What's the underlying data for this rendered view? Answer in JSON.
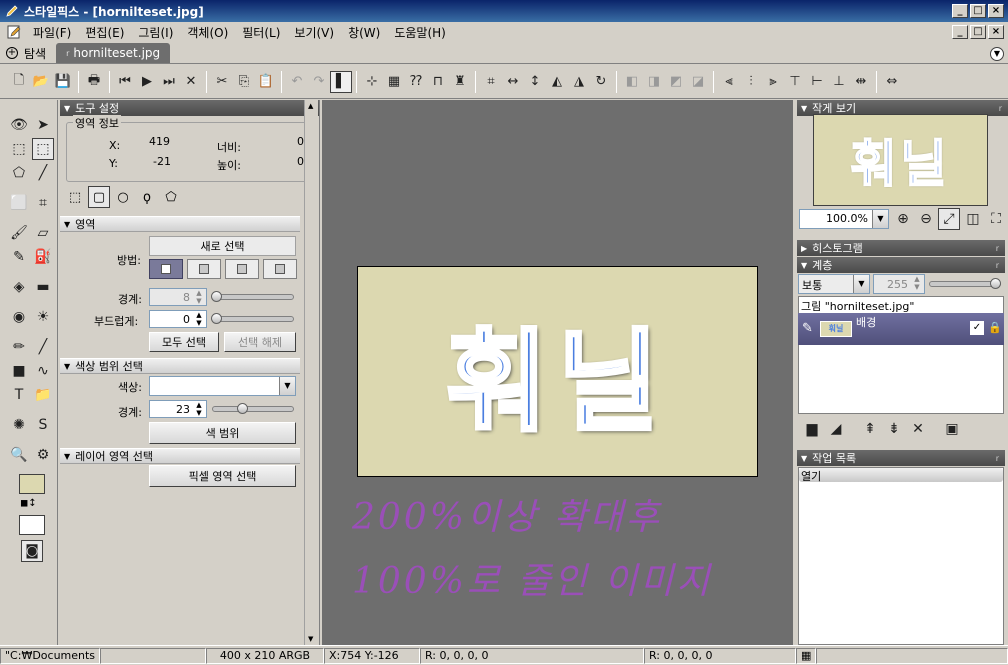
{
  "window": {
    "title": "스타일픽스 - [hornilteset.jpg]",
    "min": "_",
    "max": "□",
    "close": "×"
  },
  "menu": [
    "파일(F)",
    "편집(E)",
    "그림(I)",
    "객체(O)",
    "필터(L)",
    "보기(V)",
    "창(W)",
    "도움말(H)"
  ],
  "tabs": {
    "explore": "탐색",
    "file": "hornilteset.jpg"
  },
  "tool_settings": {
    "header": "도구 설정",
    "area_info": {
      "label": "영역 정보",
      "x_label": "X:",
      "x_value": "419",
      "y_label": "Y:",
      "y_value": "-21",
      "width_label": "너비:",
      "width_value": "0",
      "height_label": "높이:",
      "height_value": "0"
    },
    "region": {
      "header": "영역",
      "method_label": "방법:",
      "new_selection": "새로 선택",
      "border_label": "경계:",
      "border_value": "8",
      "feather_label": "부드럽게:",
      "feather_value": "0",
      "select_all": "모두 선택",
      "deselect": "선택 해제"
    },
    "color_range": {
      "header": "색상 범위 선택",
      "color_label": "색상:",
      "border_label": "경계:",
      "border_value": "23",
      "button": "색 범위"
    },
    "layer_region": {
      "header": "레이어 영역 선택",
      "button": "픽셀 영역 선택"
    }
  },
  "canvas": {
    "image_text": "훠닐",
    "note_line1": "200%이상 확대후",
    "note_line2": "100%로 줄인 이미지"
  },
  "navigator": {
    "header": "작게 보기",
    "zoom": "100.0%",
    "thumb_text": "훠닐"
  },
  "histogram": {
    "header": "히스토그램"
  },
  "layers": {
    "header": "계층",
    "blend_mode": "보통",
    "opacity": "255",
    "image_name": "그림 \"hornilteset.jpg\"",
    "layer_thumb_text": "훠닐",
    "layer_name": "배경"
  },
  "history": {
    "header": "작업 목록",
    "item": "열기"
  },
  "status": {
    "path": "\"C:₩Documents a",
    "size": "400 x 210 ARGB",
    "coords": "X:754 Y:-126",
    "rgba1": "R: 0, 0, 0, 0",
    "rgba2": "R: 0, 0, 0, 0"
  },
  "colors": {
    "accent": "#0a246a",
    "image_bg": "#dcd8b0",
    "text_blue": "#4a7ee0",
    "note_purple": "#9a4fb8",
    "canvas_bg": "#6e6e6e"
  }
}
